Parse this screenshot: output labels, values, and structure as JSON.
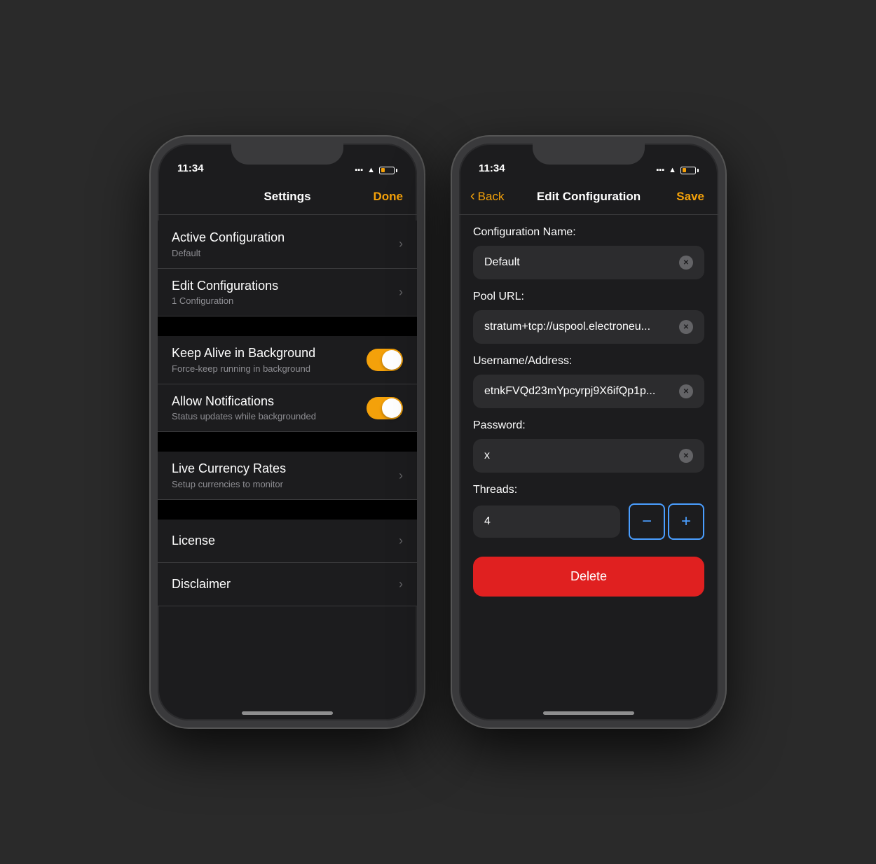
{
  "colors": {
    "accent": "#f4a10a",
    "blue": "#4a9eff",
    "delete_red": "#e02020",
    "dark_bg": "#1c1c1e",
    "input_bg": "#2c2c2e"
  },
  "left_phone": {
    "status": {
      "time": "11:34"
    },
    "nav": {
      "title": "Settings",
      "done_label": "Done"
    },
    "items": [
      {
        "title": "Active Configuration",
        "subtitle": "Default",
        "type": "nav"
      },
      {
        "title": "Edit Configurations",
        "subtitle": "1 Configuration",
        "type": "nav"
      },
      {
        "title": "Keep Alive in Background",
        "subtitle": "Force-keep running in background",
        "type": "toggle",
        "value": true
      },
      {
        "title": "Allow Notifications",
        "subtitle": "Status updates while backgrounded",
        "type": "toggle",
        "value": true
      },
      {
        "title": "Live Currency Rates",
        "subtitle": "Setup currencies to monitor",
        "type": "nav"
      },
      {
        "title": "License",
        "subtitle": "",
        "type": "nav"
      },
      {
        "title": "Disclaimer",
        "subtitle": "",
        "type": "nav"
      }
    ]
  },
  "right_phone": {
    "status": {
      "time": "11:34"
    },
    "nav": {
      "back_label": "Back",
      "title": "Edit Configuration",
      "save_label": "Save"
    },
    "fields": {
      "config_name_label": "Configuration Name:",
      "config_name_value": "Default",
      "pool_url_label": "Pool URL:",
      "pool_url_value": "stratum+tcp://uspool.electroneu...",
      "username_label": "Username/Address:",
      "username_value": "etnkFVQd23mYpcyrpj9X6ifQp1p...",
      "password_label": "Password:",
      "password_value": "x",
      "threads_label": "Threads:",
      "threads_value": "4"
    },
    "stepper": {
      "minus_label": "−",
      "plus_label": "+"
    },
    "delete_label": "Delete"
  }
}
